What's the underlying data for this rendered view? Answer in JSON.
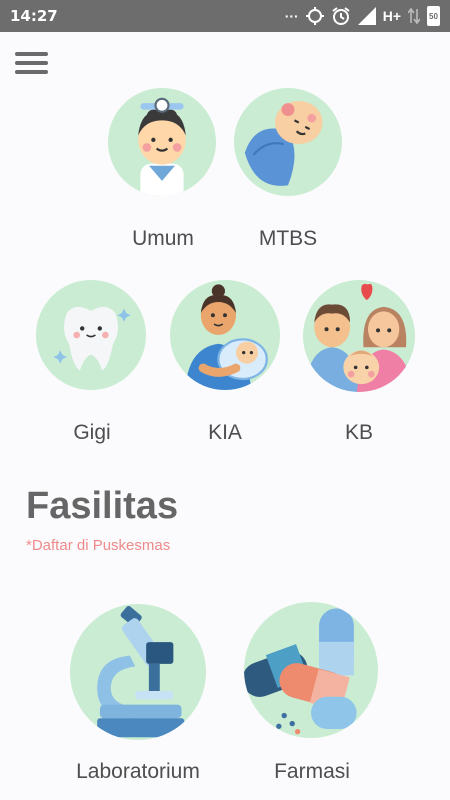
{
  "status_bar": {
    "time": "14:27",
    "more": "···",
    "network": "H+",
    "battery": "50"
  },
  "menu": {
    "icon": "hamburger-menu-icon"
  },
  "services": [
    {
      "label": "Umum",
      "icon": "doctor-icon"
    },
    {
      "label": "MTBS",
      "icon": "baby-icon"
    },
    {
      "label": "Gigi",
      "icon": "tooth-icon"
    },
    {
      "label": "KIA",
      "icon": "mother-baby-icon"
    },
    {
      "label": "KB",
      "icon": "family-icon"
    }
  ],
  "fasilitas": {
    "title": "Fasilitas",
    "subtitle": "*Daftar di Puskesmas",
    "items": [
      {
        "label": "Laboratorium",
        "icon": "microscope-icon"
      },
      {
        "label": "Farmasi",
        "icon": "pills-icon"
      }
    ]
  },
  "colors": {
    "status_bar": "#6d6d6d",
    "circle_bg": "#c9ecd2",
    "label_text": "#4e4e4e",
    "subtitle": "#ef8a8a"
  }
}
